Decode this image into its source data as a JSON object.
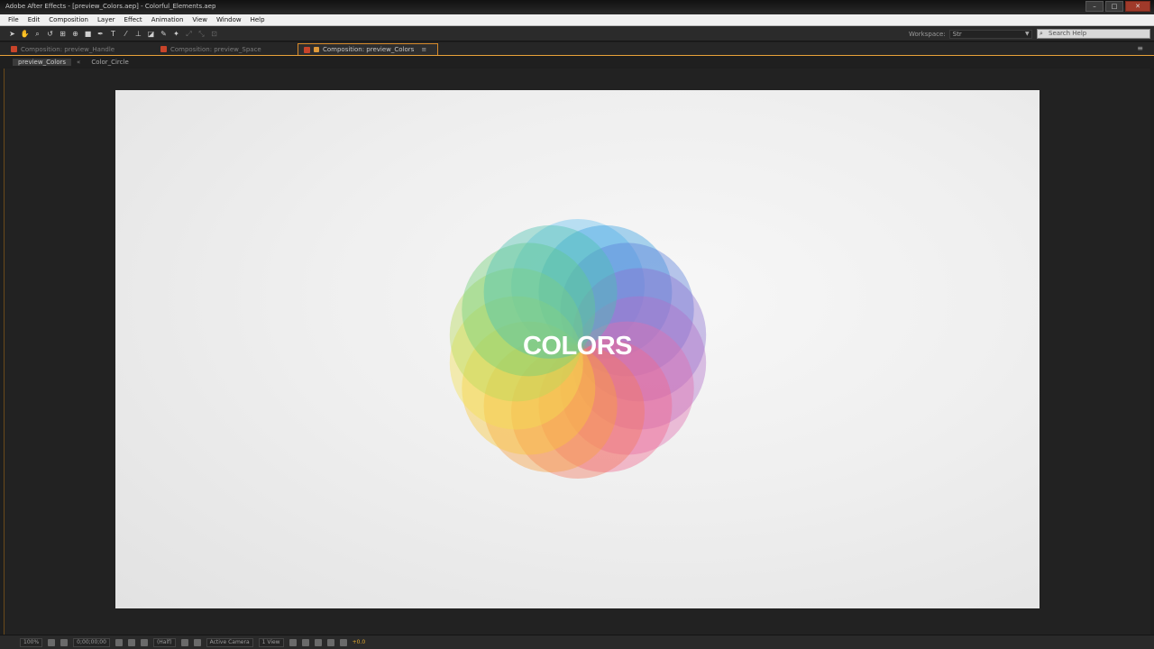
{
  "window": {
    "title": "Adobe After Effects - [preview_Colors.aep] - Colorful_Elements.aep",
    "buttons": [
      "–",
      "□",
      "✕"
    ]
  },
  "menu": {
    "items": [
      "File",
      "Edit",
      "Composition",
      "Layer",
      "Effect",
      "Animation",
      "View",
      "Window",
      "Help"
    ]
  },
  "toolbar": {
    "workspace_label": "Workspace:",
    "workspace_value": "Str",
    "search_placeholder": "Search Help"
  },
  "tabs": [
    {
      "label": "Composition: preview_Handle"
    },
    {
      "label": "Composition: preview_Space"
    },
    {
      "label": "Composition: preview_Colors",
      "active": true
    }
  ],
  "breadcrumbs": {
    "items": [
      "preview_Colors",
      "Color_Circle"
    ],
    "separator": "«"
  },
  "composition": {
    "text": "COLORS",
    "petals": [
      {
        "color": "#66c2f0"
      },
      {
        "color": "#3aa0e0"
      },
      {
        "color": "#5b7fd8"
      },
      {
        "color": "#8a70d0"
      },
      {
        "color": "#b070c8"
      },
      {
        "color": "#e070b0"
      },
      {
        "color": "#f06890"
      },
      {
        "color": "#f47a60"
      },
      {
        "color": "#f9a040"
      },
      {
        "color": "#fbc83a"
      },
      {
        "color": "#f2e050"
      },
      {
        "color": "#b8dc58"
      },
      {
        "color": "#6fcf78"
      },
      {
        "color": "#4cc0b0"
      }
    ]
  },
  "statusbar": {
    "zoom": "100%",
    "timecode": "0;00;00;00",
    "resolution": "(Half)",
    "camera": "Active Camera",
    "views": "1 View",
    "exposure": "+0.0"
  }
}
